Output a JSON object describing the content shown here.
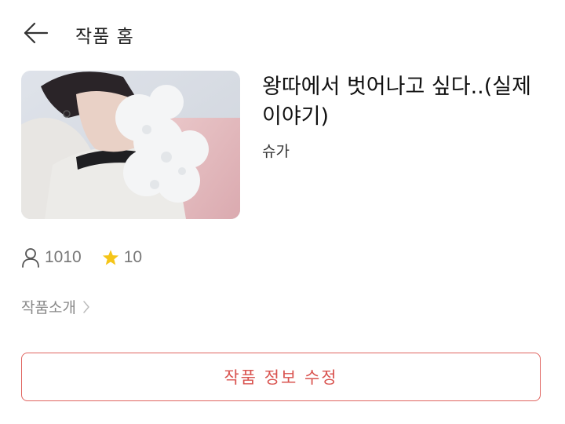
{
  "header": {
    "back_icon": "arrow-left-icon",
    "title": "작품 홈"
  },
  "work": {
    "title": "왕따에서 벗어나고 싶다..(실제이야기)",
    "author": "슈가"
  },
  "stats": {
    "readers_icon": "person-icon",
    "readers": "1010",
    "stars_icon": "star-icon",
    "stars": "10",
    "star_color": "#f5c518"
  },
  "intro": {
    "label": "작품소개",
    "icon": "chevron-right-icon"
  },
  "edit_button": {
    "label": "작품 정보 수정",
    "color": "#d9534f"
  }
}
